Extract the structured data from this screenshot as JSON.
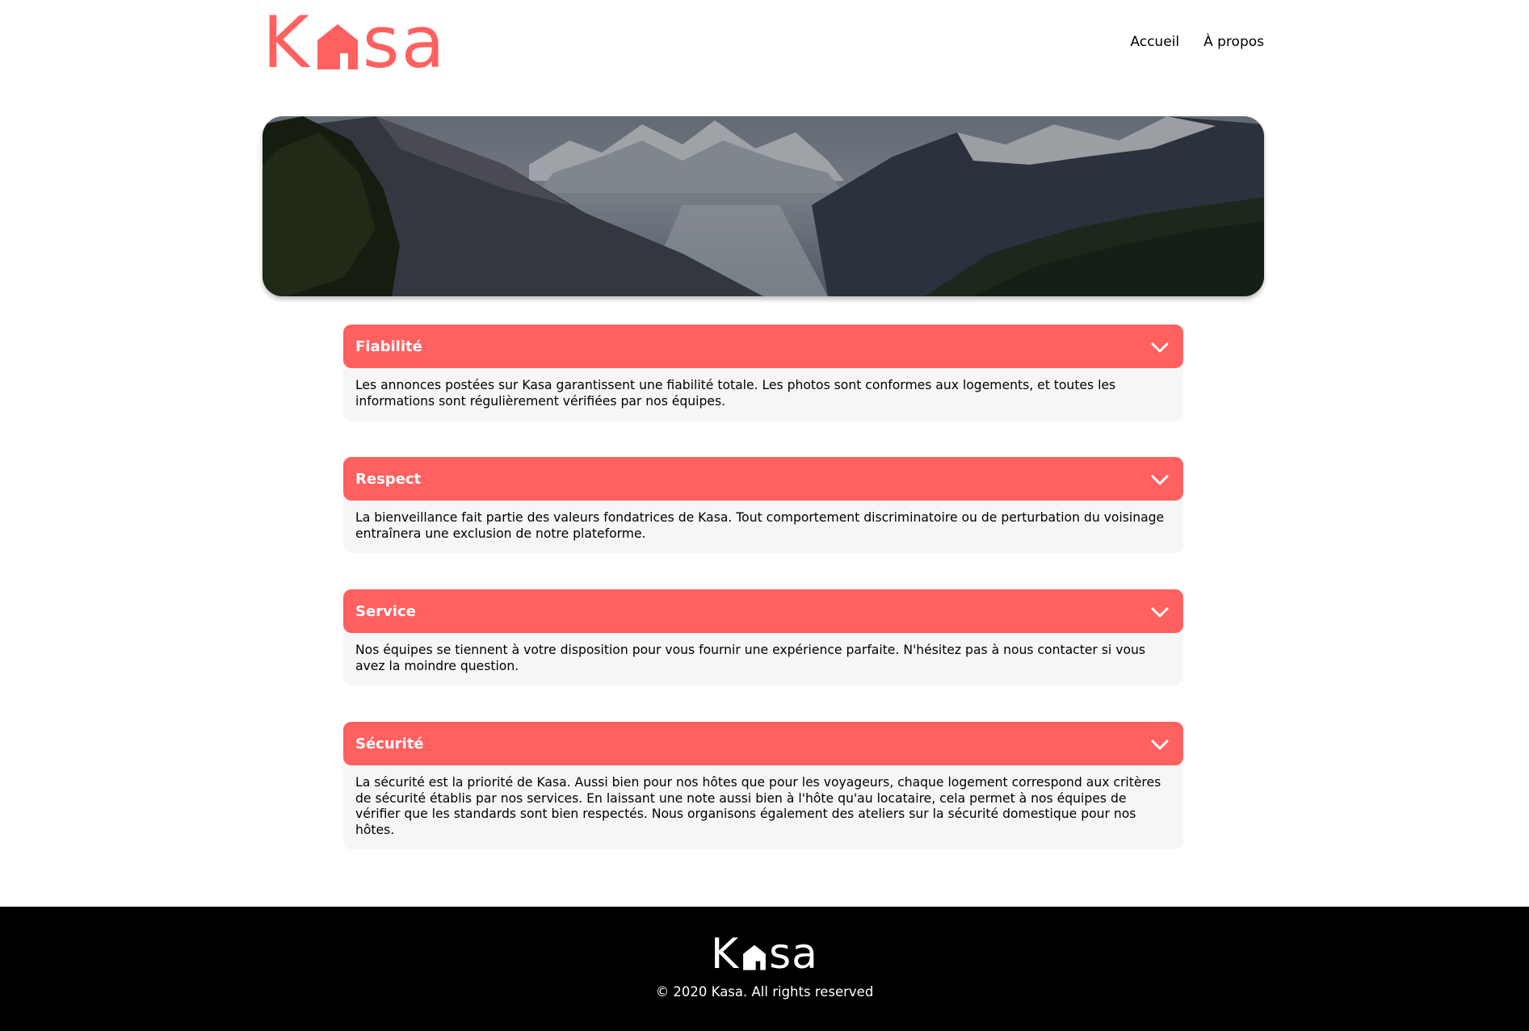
{
  "brand": {
    "logo_letters": [
      "K",
      "sa"
    ],
    "accent_color": "#FF6060",
    "logo_icon": "house-icon"
  },
  "nav": {
    "items": [
      {
        "label": "Accueil"
      },
      {
        "label": "À propos"
      }
    ]
  },
  "banner": {
    "image": "mountain-valley-landscape"
  },
  "collapses": [
    {
      "title": "Fiabilité",
      "text": "Les annonces postées sur Kasa garantissent une fiabilité totale. Les photos sont conformes aux logements, et toutes les informations sont régulièrement vérifiées par nos équipes.",
      "icon": "chevron-down-icon"
    },
    {
      "title": "Respect",
      "text": "La bienveillance fait partie des valeurs fondatrices de Kasa. Tout comportement discriminatoire ou de perturbation du voisinage entraînera une exclusion de notre plateforme.",
      "icon": "chevron-down-icon"
    },
    {
      "title": "Service",
      "text": "Nos équipes se tiennent à votre disposition pour vous fournir une expérience parfaite. N'hésitez pas à nous contacter si vous avez la moindre question.",
      "icon": "chevron-down-icon"
    },
    {
      "title": "Sécurité",
      "text": "La sécurité est la priorité de Kasa. Aussi bien pour nos hôtes que pour les voyageurs, chaque logement correspond aux critères de sécurité établis par nos services. En laissant une note aussi bien à l'hôte qu'au locataire, cela permet à nos équipes de vérifier que les standards sont bien respectés. Nous organisons également des ateliers sur la sécurité domestique pour nos hôtes.",
      "icon": "chevron-down-icon"
    }
  ],
  "footer": {
    "logo_letters": [
      "K",
      "sa"
    ],
    "copyright": "© 2020 Kasa. All rights reserved",
    "background": "#000000"
  },
  "colors": {
    "collapse_header": "#FF6060",
    "collapse_body": "#F6F6F6",
    "text": "#000000"
  }
}
